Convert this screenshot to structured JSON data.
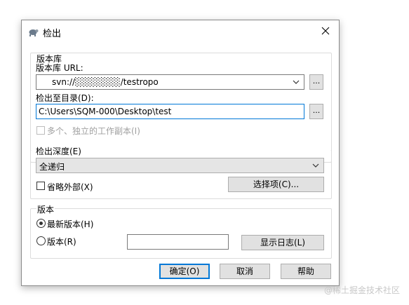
{
  "dialog": {
    "title": "检出",
    "icon": "tortoise-icon",
    "close_icon": "close-icon"
  },
  "repository": {
    "group_title": "版本库",
    "url_label": "版本库 URL:",
    "url_value": "svn://░░░░░░░/testropo",
    "browse_label": "...",
    "checkout_dir_label": "检出至目录(D):",
    "checkout_dir_value": "C:\\Users\\SQM-000\\Desktop\\test",
    "browse_dir_label": "...",
    "multi_copy_label": "多个、独立的工作副本(I)"
  },
  "depth": {
    "group_title": "检出深度(E)",
    "selected": "全递归",
    "omit_externals_label": "省略外部(X)",
    "choose_items_label": "选择项(C)..."
  },
  "revision": {
    "group_title": "版本",
    "head_label": "最新版本(H)",
    "revision_label": "版本(R)",
    "revision_value": "",
    "show_log_label": "显示日志(L)"
  },
  "footer": {
    "ok_label": "确定(O)",
    "cancel_label": "取消",
    "help_label": "帮助"
  },
  "watermark": "@稀土掘金技术社区",
  "colors": {
    "accent": "#0078d7",
    "border": "#7a7a7a",
    "button_bg": "#e1e1e1"
  }
}
